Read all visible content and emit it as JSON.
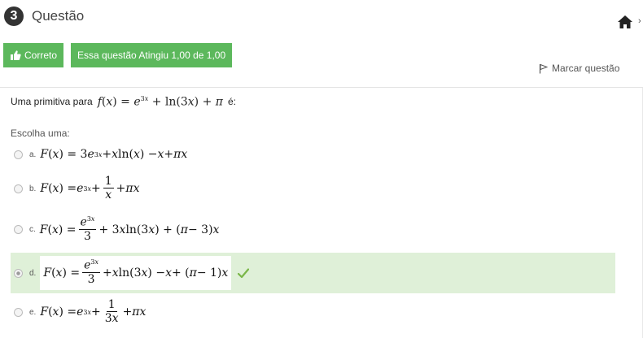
{
  "question": {
    "number": "3",
    "title": "Questão",
    "flag_label": "Marcar questão",
    "status_label": "Correto",
    "score_label": "Essa questão Atingiu 1,00 de 1,00",
    "text_prefix": "Uma primitiva para",
    "text_suffix": "é:",
    "prompt": "Escolha uma:"
  },
  "options": [
    {
      "letter": "a."
    },
    {
      "letter": "b."
    },
    {
      "letter": "c."
    },
    {
      "letter": "d."
    },
    {
      "letter": "e."
    }
  ],
  "selected_option": "d",
  "icons": {
    "home": "home-icon",
    "thumb": "thumbs-up-icon",
    "flag": "flag-icon",
    "check": "checkmark-icon"
  },
  "colors": {
    "success": "#5cb85c",
    "selected_bg": "#dff0d8",
    "check": "#7ab648"
  }
}
